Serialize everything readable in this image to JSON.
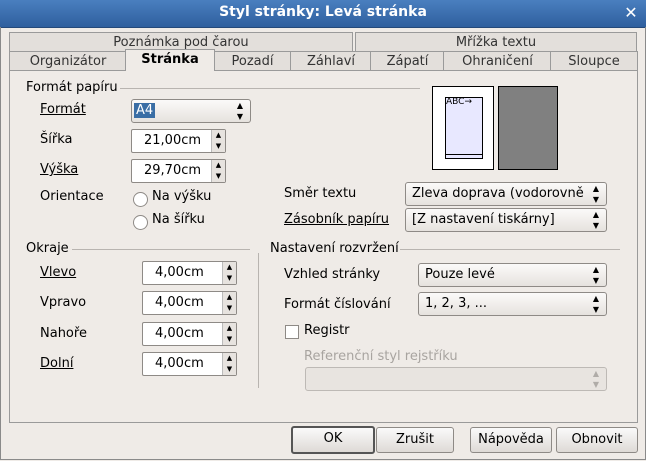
{
  "window": {
    "title": "Styl stránky: Levá stránka"
  },
  "tabs": {
    "row1": [
      "Poznámka pod čarou",
      "Mřížka textu"
    ],
    "row2": [
      "Organizátor",
      "Stránka",
      "Pozadí",
      "Záhlaví",
      "Zápatí",
      "Ohraničení",
      "Sloupce"
    ]
  },
  "paper": {
    "section": "Formát papíru",
    "format_label": "Formát",
    "format_value": "A4",
    "width_label": "Šířka",
    "width_value": "21,00cm",
    "height_label": "Výška",
    "height_value": "29,70cm",
    "orientation_label": "Orientace",
    "portrait": "Na výšku",
    "landscape": "Na šířku",
    "text_dir_label": "Směr textu",
    "text_dir_value": "Zleva doprava (vodorovně",
    "tray_label": "Zásobník papíru",
    "tray_value": "[Z nastavení tiskárny]",
    "preview_text": "ABC→"
  },
  "margins": {
    "section": "Okraje",
    "left_label": "Vlevo",
    "left_value": "4,00cm",
    "right_label": "Vpravo",
    "right_value": "4,00cm",
    "top_label": "Nahoře",
    "top_value": "4,00cm",
    "bottom_label": "Dolní",
    "bottom_value": "4,00cm"
  },
  "layout": {
    "section": "Nastavení rozvržení",
    "view_label": "Vzhled stránky",
    "view_value": "Pouze levé",
    "numbering_label": "Formát číslování",
    "numbering_value": "1, 2, 3, ...",
    "register_label": "Registr",
    "ref_style_label": "Referenční styl rejstříku",
    "ref_style_value": ""
  },
  "buttons": {
    "ok": "OK",
    "cancel": "Zrušit",
    "help": "Nápověda",
    "reset": "Obnovit"
  }
}
